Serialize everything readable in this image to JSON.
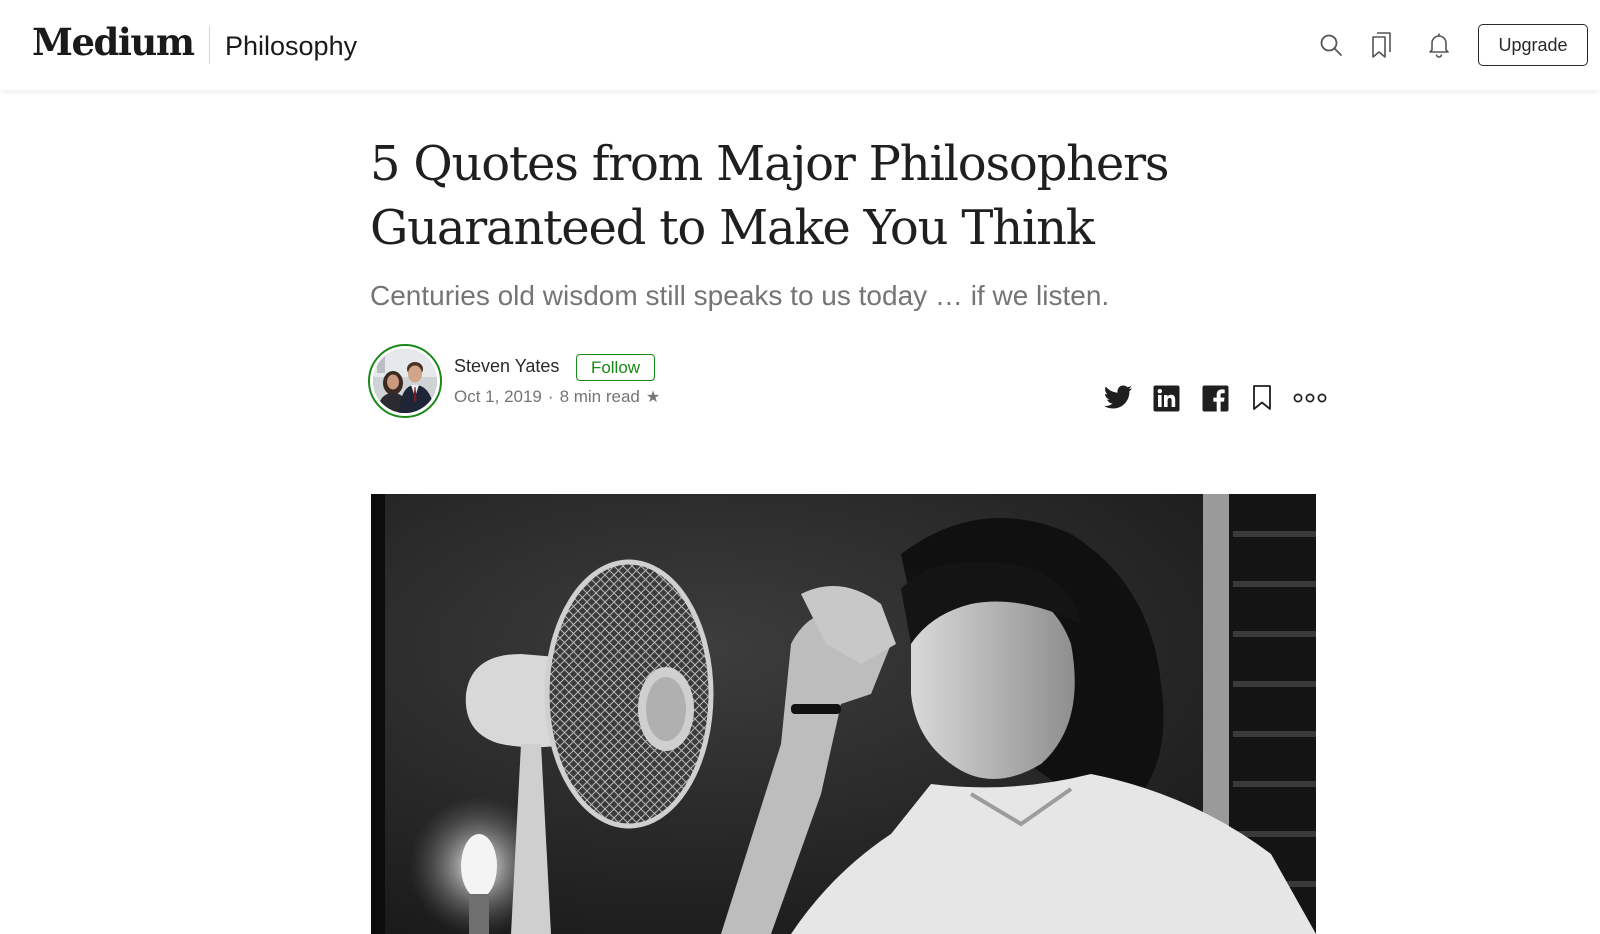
{
  "topbar": {
    "logo_text": "Medium",
    "publication": "Philosophy",
    "upgrade_label": "Upgrade",
    "icons": [
      "search-icon",
      "bookmarks-icon",
      "notifications-icon"
    ]
  },
  "article": {
    "title_line1": "5 Quotes from Major Philosophers",
    "title_line2": "Guaranteed to Make You Think",
    "subtitle": "Centuries old wisdom still speaks to us today … if we listen.",
    "author": "Steven Yates",
    "follow_label": "Follow",
    "date": "Oct 1, 2019",
    "separator": "·",
    "read_time": "8 min read",
    "member_star": "★",
    "share_icons": [
      "twitter-icon",
      "linkedin-icon",
      "facebook-icon",
      "bookmark-icon",
      "more-icon"
    ]
  },
  "colors": {
    "accent_green": "#1a8917",
    "text_dark": "#292929",
    "text_muted": "#757575"
  }
}
